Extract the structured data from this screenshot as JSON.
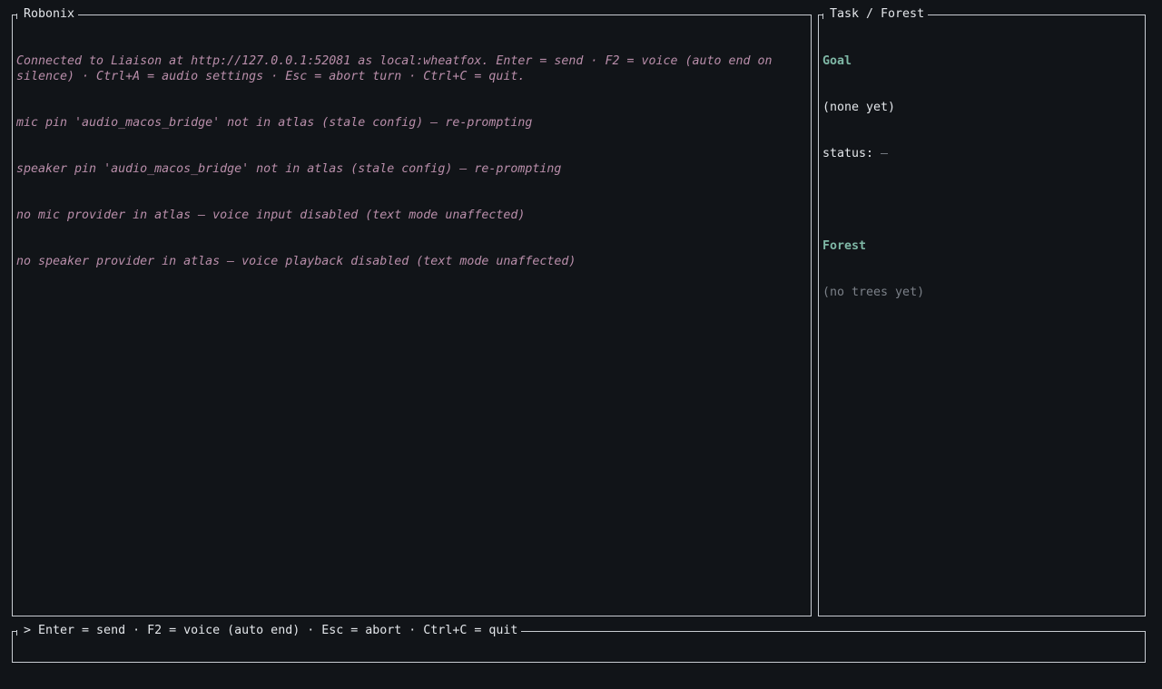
{
  "chat_panel": {
    "title": "Robonix",
    "log_lines": [
      "Connected to Liaison at http://127.0.0.1:52081 as local:wheatfox. Enter = send · F2 = voice (auto end on silence) · Ctrl+A = audio settings · Esc = abort turn · Ctrl+C = quit.",
      "mic pin 'audio_macos_bridge' not in atlas (stale config) — re-prompting",
      "speaker pin 'audio_macos_bridge' not in atlas (stale config) — re-prompting",
      "no mic provider in atlas — voice input disabled (text mode unaffected)",
      "no speaker provider in atlas — voice playback disabled (text mode unaffected)"
    ]
  },
  "task_panel": {
    "title": "Task / Forest",
    "goal_heading": "Goal",
    "goal_value": "(none yet)",
    "status_label": "status: ",
    "status_value": "—",
    "forest_heading": "Forest",
    "forest_value": "(no trees yet)"
  },
  "input_panel": {
    "title": "> Enter = send · F2 = voice (auto end) · Esc = abort · Ctrl+C = quit",
    "value": ""
  },
  "colors": {
    "background": "#111418",
    "border": "#c8ccd2",
    "system_log": "#b98eaa",
    "heading_accent": "#7fb8a6",
    "muted": "#7b8088"
  }
}
